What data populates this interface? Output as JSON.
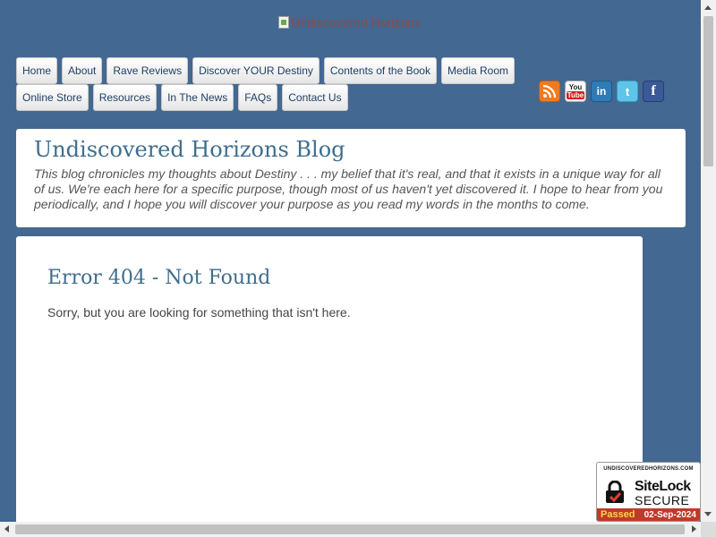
{
  "header": {
    "logo_alt": "Undiscovered Horizons"
  },
  "nav": {
    "row1": [
      "Home",
      "About",
      "Rave Reviews",
      "Discover YOUR Destiny",
      "Contents of the Book",
      "Media Room"
    ],
    "row2": [
      "Online Store",
      "Resources",
      "In The News",
      "FAQs",
      "Contact Us"
    ]
  },
  "social": {
    "rss": "rss-icon",
    "youtube_top": "You",
    "youtube_bottom": "Tube",
    "linkedin": "in",
    "twitter": "t",
    "facebook": "f"
  },
  "blog": {
    "title": "Undiscovered Horizons Blog",
    "description": "This blog chronicles my thoughts about Destiny . . . my belief that it's real, and that it exists in a unique way for all of us. We're each here for a specific purpose, though most of us haven't yet discovered it. I hope to hear from you periodically, and I hope you will discover your purpose as you read my words in the months to come."
  },
  "main": {
    "error_title": "Error 404 - Not Found",
    "error_message": "Sorry, but you are looking for something that isn't here."
  },
  "sitelock": {
    "domain": "UNDISCOVEREDHORIZONS.COM",
    "brand": "SiteLock",
    "secure": "SECURE",
    "status": "Passed",
    "date": "02-Sep-2024"
  },
  "colors": {
    "background": "#436891",
    "title": "#3e6e8e",
    "nav_text": "#1f3f66",
    "sitelock_bar": "#c0392b"
  }
}
